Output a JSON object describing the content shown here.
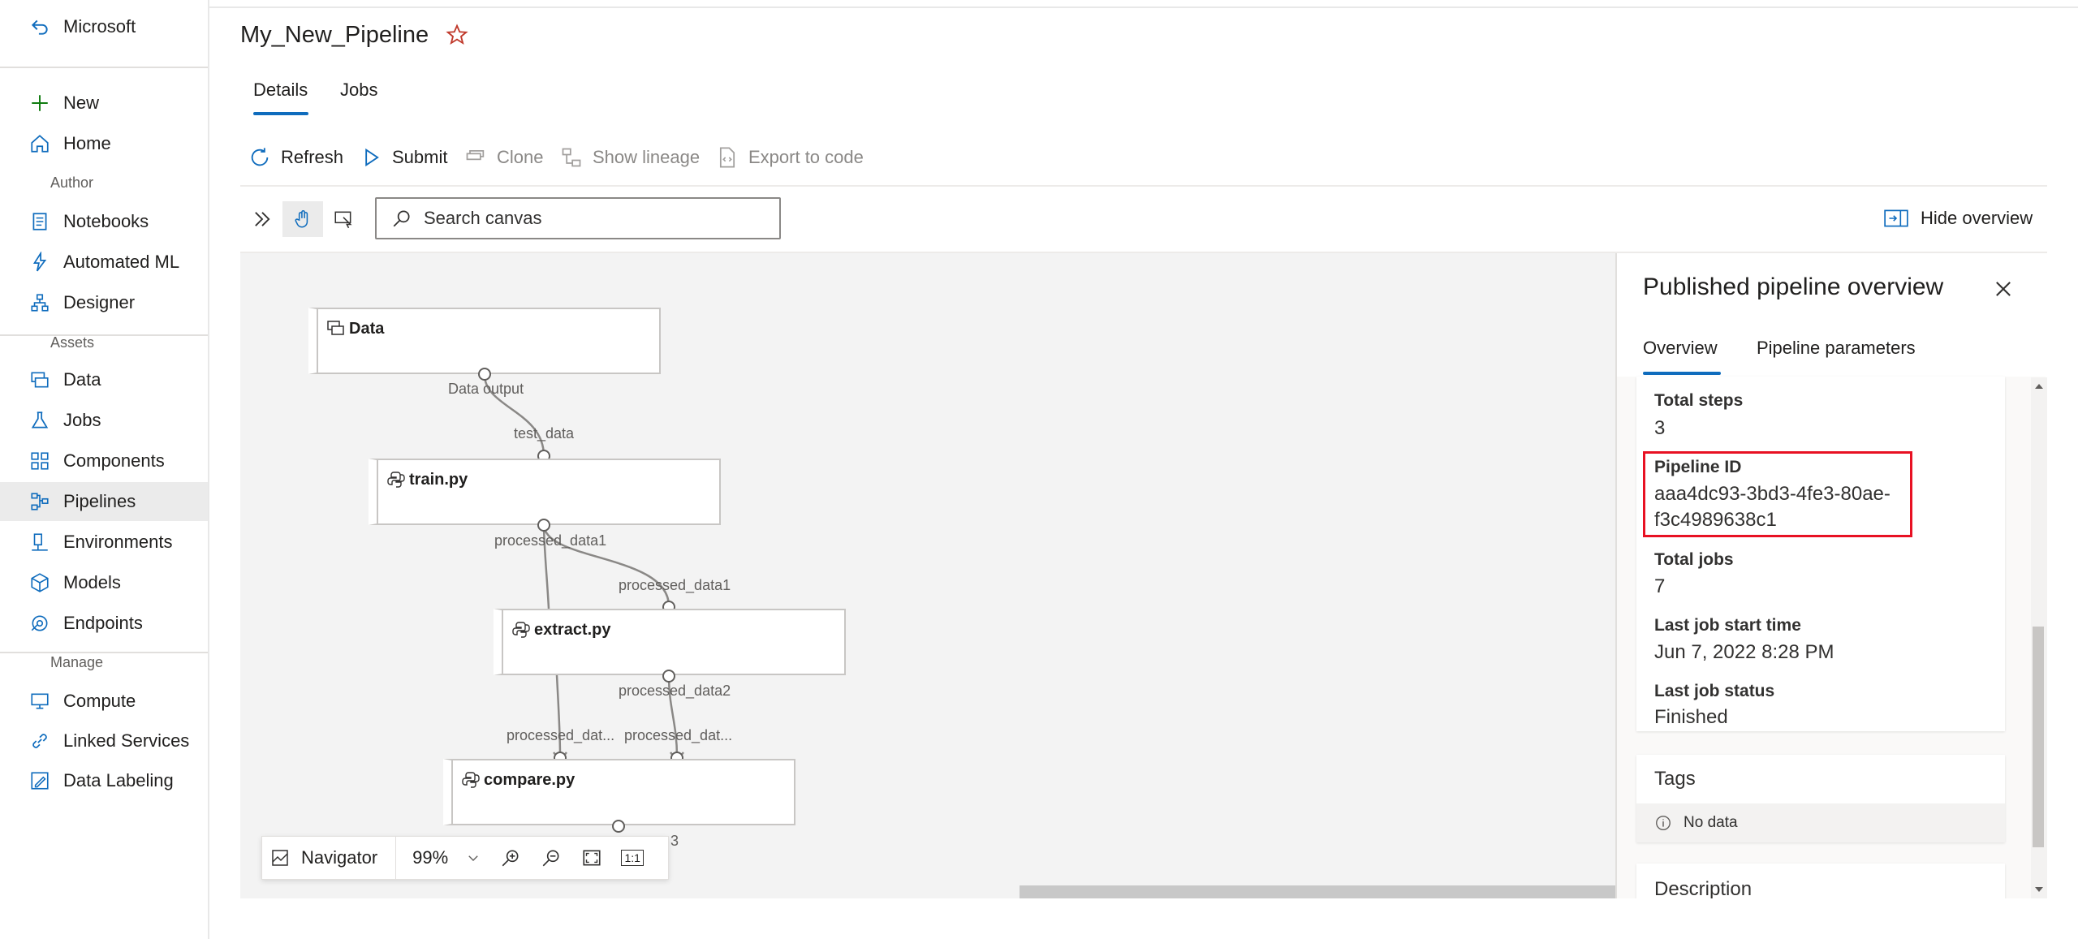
{
  "sidebar": {
    "top_link": "Microsoft",
    "items": [
      {
        "label": "New",
        "icon": "plus-icon"
      },
      {
        "label": "Home",
        "icon": "home-icon"
      }
    ],
    "author_section": "Author",
    "author_items": [
      {
        "label": "Notebooks",
        "icon": "notebook-icon"
      },
      {
        "label": "Automated ML",
        "icon": "automl-icon"
      },
      {
        "label": "Designer",
        "icon": "designer-icon"
      }
    ],
    "assets_section": "Assets",
    "assets_items": [
      {
        "label": "Data",
        "icon": "data-icon"
      },
      {
        "label": "Jobs",
        "icon": "flask-icon"
      },
      {
        "label": "Components",
        "icon": "components-icon"
      },
      {
        "label": "Pipelines",
        "icon": "pipeline-icon",
        "active": true
      },
      {
        "label": "Environments",
        "icon": "environment-icon"
      },
      {
        "label": "Models",
        "icon": "cube-icon"
      },
      {
        "label": "Endpoints",
        "icon": "endpoint-icon"
      }
    ],
    "manage_section": "Manage",
    "manage_items": [
      {
        "label": "Compute",
        "icon": "compute-icon"
      },
      {
        "label": "Linked Services",
        "icon": "link-icon"
      },
      {
        "label": "Data Labeling",
        "icon": "labeling-icon"
      }
    ]
  },
  "header": {
    "title": "My_New_Pipeline",
    "tabs": [
      "Details",
      "Jobs"
    ],
    "active_tab": "Details"
  },
  "toolbar": {
    "refresh": "Refresh",
    "submit": "Submit",
    "clone": "Clone",
    "show_lineage": "Show lineage",
    "export": "Export to code"
  },
  "canvas_bar": {
    "search_placeholder": "Search canvas",
    "hide_overview": "Hide overview"
  },
  "graph": {
    "nodes": [
      {
        "name": "Data",
        "icon": "dataset-icon"
      },
      {
        "name": "train.py",
        "icon": "python-icon"
      },
      {
        "name": "extract.py",
        "icon": "python-icon"
      },
      {
        "name": "compare.py",
        "icon": "python-icon"
      }
    ],
    "port_labels": {
      "data_output": "Data output",
      "test_data": "test_data",
      "train_out": "processed_data1",
      "extract_in": "processed_data1",
      "extract_out": "processed_data2",
      "compare_in1": "processed_dat...",
      "compare_in2": "processed_dat...",
      "compare_out": "3"
    }
  },
  "navigator": {
    "label": "Navigator",
    "zoom": "99%",
    "actual_size": "1:1"
  },
  "panel": {
    "title": "Published pipeline overview",
    "tabs": [
      "Overview",
      "Pipeline parameters"
    ],
    "fields": {
      "total_steps_label": "Total steps",
      "total_steps": "3",
      "pipeline_id_label": "Pipeline ID",
      "pipeline_id_line1": "aaa4dc93-3bd3-4fe3-80ae-",
      "pipeline_id_line2": "f3c4989638c1",
      "total_jobs_label": "Total jobs",
      "total_jobs": "7",
      "last_start_label": "Last job start time",
      "last_start": "Jun 7, 2022 8:28 PM",
      "last_status_label": "Last job status",
      "last_status": "Finished"
    },
    "tags_title": "Tags",
    "tags_empty": "No data",
    "description_title": "Description"
  },
  "colors": {
    "accent": "#0f6cbd",
    "highlight": "#e81123",
    "star": "#c0392b"
  }
}
